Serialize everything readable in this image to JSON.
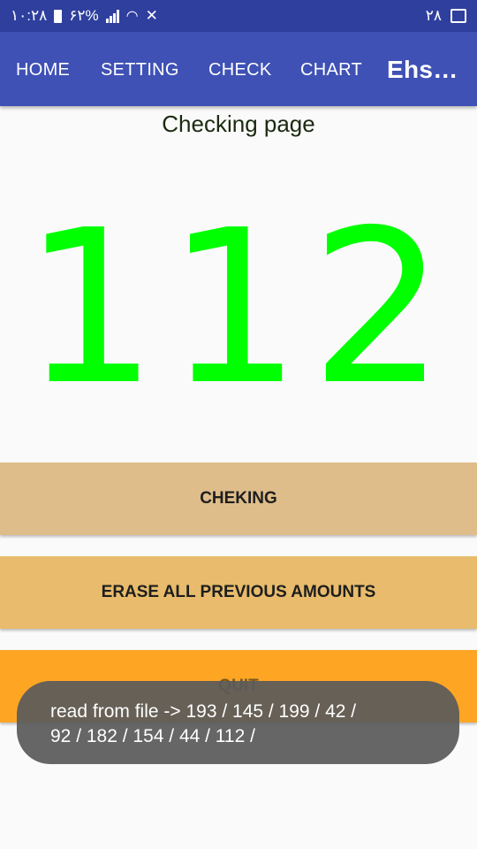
{
  "status_bar": {
    "time": "۱۰:۲۸",
    "battery": "۶۲%",
    "right_text": "۲۸",
    "icons": [
      "battery-icon",
      "signal-icon",
      "wifi-icon",
      "mute-icon",
      "image-icon"
    ]
  },
  "toolbar": {
    "tabs": [
      {
        "label": "HOME"
      },
      {
        "label": "SETTING"
      },
      {
        "label": "CHECK"
      },
      {
        "label": "CHART"
      },
      {
        "label": "Ehs…"
      }
    ],
    "background": "#3f51b5"
  },
  "main": {
    "title": "Checking page",
    "value": "112",
    "value_color": "#00ff00"
  },
  "buttons": {
    "checking": "CHEKING",
    "erase": "ERASE ALL PREVIOUS AMOUNTS",
    "quit": "QUIT"
  },
  "toast": {
    "line1": "read from file -> 193 /  145 /  199 /  42 /",
    "line2": "92 /  182 /  154 /  44 /  112 /"
  }
}
